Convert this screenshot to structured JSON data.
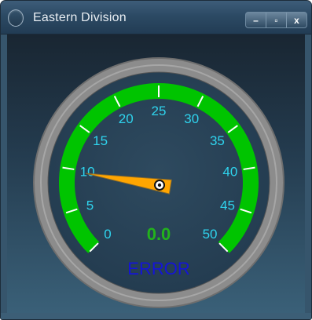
{
  "window": {
    "title": "Eastern Division",
    "controls": {
      "minimize": "–",
      "maximize": "▫",
      "close": "x"
    }
  },
  "gauge": {
    "min": 0,
    "max": 50,
    "major_ticks": [
      "0",
      "5",
      "10",
      "15",
      "20",
      "25",
      "30",
      "35",
      "40",
      "45",
      "50"
    ],
    "value_display": "0.0",
    "status_text": "ERROR",
    "needle_value": 10,
    "colors": {
      "band": "#00c400",
      "tick_label": "#2fd4ee",
      "value_text": "#22b21c",
      "status_text": "#1414d8",
      "needle": "#ffa500",
      "bezel": "#8c8c8c"
    }
  }
}
